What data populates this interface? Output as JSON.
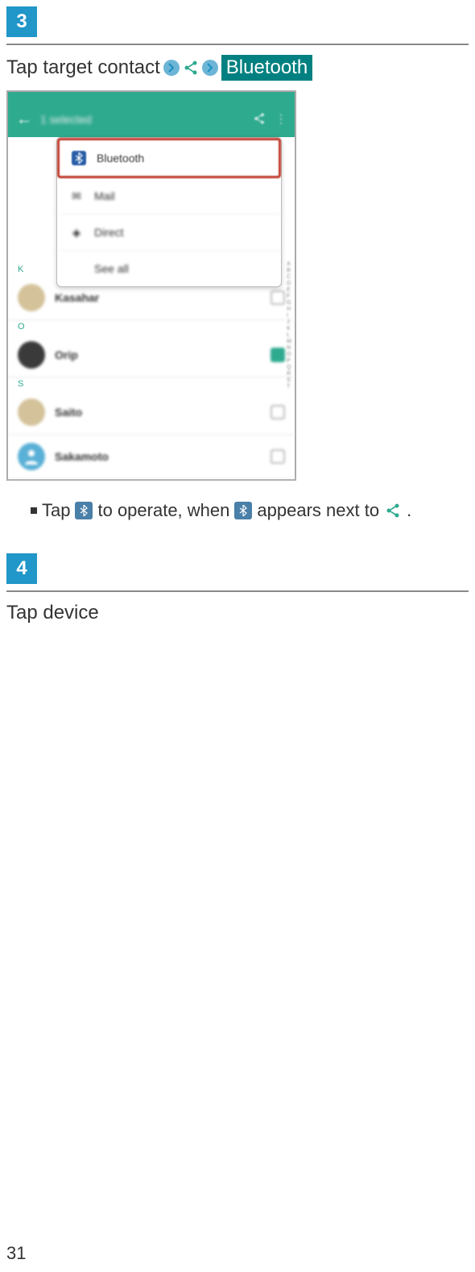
{
  "step3": {
    "number": "3",
    "text_before": "Tap target contact",
    "bluetooth_label": "Bluetooth"
  },
  "screenshot": {
    "header_title": "1 selected",
    "popup": {
      "bluetooth": "Bluetooth",
      "mail": "Mail",
      "direct": "Direct",
      "see_all": "See all"
    },
    "contacts": [
      {
        "name": "Kasahar",
        "checked": false
      },
      {
        "name": "Orip",
        "checked": true
      },
      {
        "name": "Saito",
        "checked": false
      },
      {
        "name": "Sakamoto",
        "checked": false
      }
    ]
  },
  "bullet": {
    "tap": "Tap",
    "to_operate": "to operate, when",
    "appears": "appears next to",
    "period": "."
  },
  "step4": {
    "number": "4",
    "text": "Tap device"
  },
  "page_number": "31"
}
